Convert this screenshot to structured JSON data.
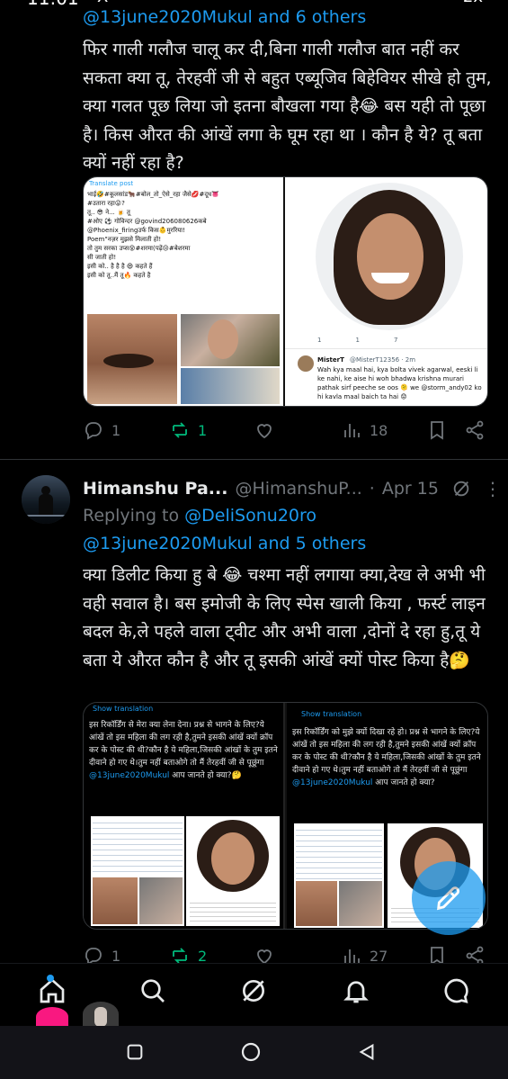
{
  "status_bar": {
    "time": "11:01",
    "app_glyph": "X",
    "right": "2x"
  },
  "post1": {
    "mentions": "@13june2020Mukul and 6 others",
    "text": "फिर गाली गलौज चालू कर दी,बिना गाली गलौज बात नहीं कर सकता क्या तू, तेरहवीं जी से बहुत एब्यूजिव बिहेवियर सीखे हो तुम, क्या गलत पूछ लिया जो इतना बौखला गया है😂 बस यही तो पूछा है। किस औरत की आंखें लगा के घूम रहा था । कौन है ये? तू बता क्यों नहीं रहा है?",
    "media": {
      "translate_label": "Translate post",
      "left_lines": [
        "भाई🤣#कूलसांड🐂#बोल_तो_ऐसे_रहा जैसे💋#दूध👅",
        "#उतारा रहा😜?",
        "तू.. 😎 ने... 🍺 तू",
        "#ओए ⚽ गोविन्दर @govind206080626कबे",
        "@Phoenix_firingउर्फ किस👶मुररिया!",
        "Poem\"नज़र मुझसे मिलाती हो!",
        "तो तुम सरका उप्स😵#शरमा(पढ़ें😒#बेशरमा",
        "सी जाती हो!",
        "इसी को.. है है है 😄 कहते हैं",
        "इसी को तू..मैं तू🔥 कहते है"
      ],
      "reply_name": "MisterT",
      "reply_handle": "@MisterT12356 · 2m",
      "reply_text": "Wah kya maal hai, kya bolta vivek agarwal, eeski li ke nahi, ke aise hi woh bhadwa krishna murari pathak sirf peeche se oos 🫠 we @storm_andy02 ko hi kavla maal baich ta hai 😟",
      "stats_left": [
        "1",
        "1",
        "7"
      ]
    },
    "actions": {
      "replies": "1",
      "reposts": "1",
      "likes": "",
      "views": "18"
    }
  },
  "post2": {
    "name": "Himanshu Pa...",
    "handle": "@HimanshuP...",
    "dot": "·",
    "date": "Apr 15",
    "replying_to_label": "Replying to",
    "replying_to_user": "@DeliSonu20ro",
    "mentions": "@13june2020Mukul and 5 others",
    "text": "क्या डिलीट किया हु बे 😂 चश्मा नहीं लगाया क्या,देख ले अभी भी वही सवाल है। बस इमोजी के लिए स्पेस खाली किया , फर्स्ट लाइन बदल के,ले पहले वाला ट्वीट और अभी वाला ,दोनों दे रहा हु,तू ये बता ये औरत कौन है और तू इसकी आंखें क्यों पोस्ट किया है🤔",
    "media": {
      "left": {
        "show_translation": "Show translation",
        "text": "इस रिकॉर्डिंग से मेरा क्या लेना देना। प्रश्न से भागने के लिए?ये आंखें तो इस महिला की लग रही है,तुमने इसकी आंखें क्यों क्रॉप कर के पोस्ट की थी?कौन है ये महिला,जिसकी आंखों के तुम इतने दीवाने हो गए थे।तुम नहीं बताओगे तो मैं तेरहवीं जी से पूछूंगा",
        "mention": "@13june2020Mukul",
        "tail": "आप जानते हो क्या?🤔"
      },
      "right": {
        "show_translation": "Show translation",
        "text": "इस रिकॉर्डिंग को मुझे क्यों दिखा रहे हो। प्रश्न से भागने के लिए?ये आंखें तो इस महिला की लग रही है,तुमने इसकी आंखें क्यों क्रॉप कर के पोस्ट की थी?कौन है ये महिला,जिसकी आंखों के तुम इतने दीवाने हो गए थे।तुम नहीं बताओगे तो मैं तेरहवीं जी से पूछूंगा",
        "mention": "@13june2020Mukul",
        "tail": "आप जानते हो क्या?"
      }
    },
    "actions": {
      "replies": "1",
      "reposts": "2",
      "likes": "",
      "views": "27"
    }
  },
  "colors": {
    "accent": "#1d9bf0",
    "repost_green": "#00ba7c",
    "muted": "#71767b",
    "notif_badge": "#f91880"
  },
  "bottom_nav": [
    "home-icon",
    "search-icon",
    "grok-icon",
    "notifications-icon",
    "messages-icon"
  ]
}
